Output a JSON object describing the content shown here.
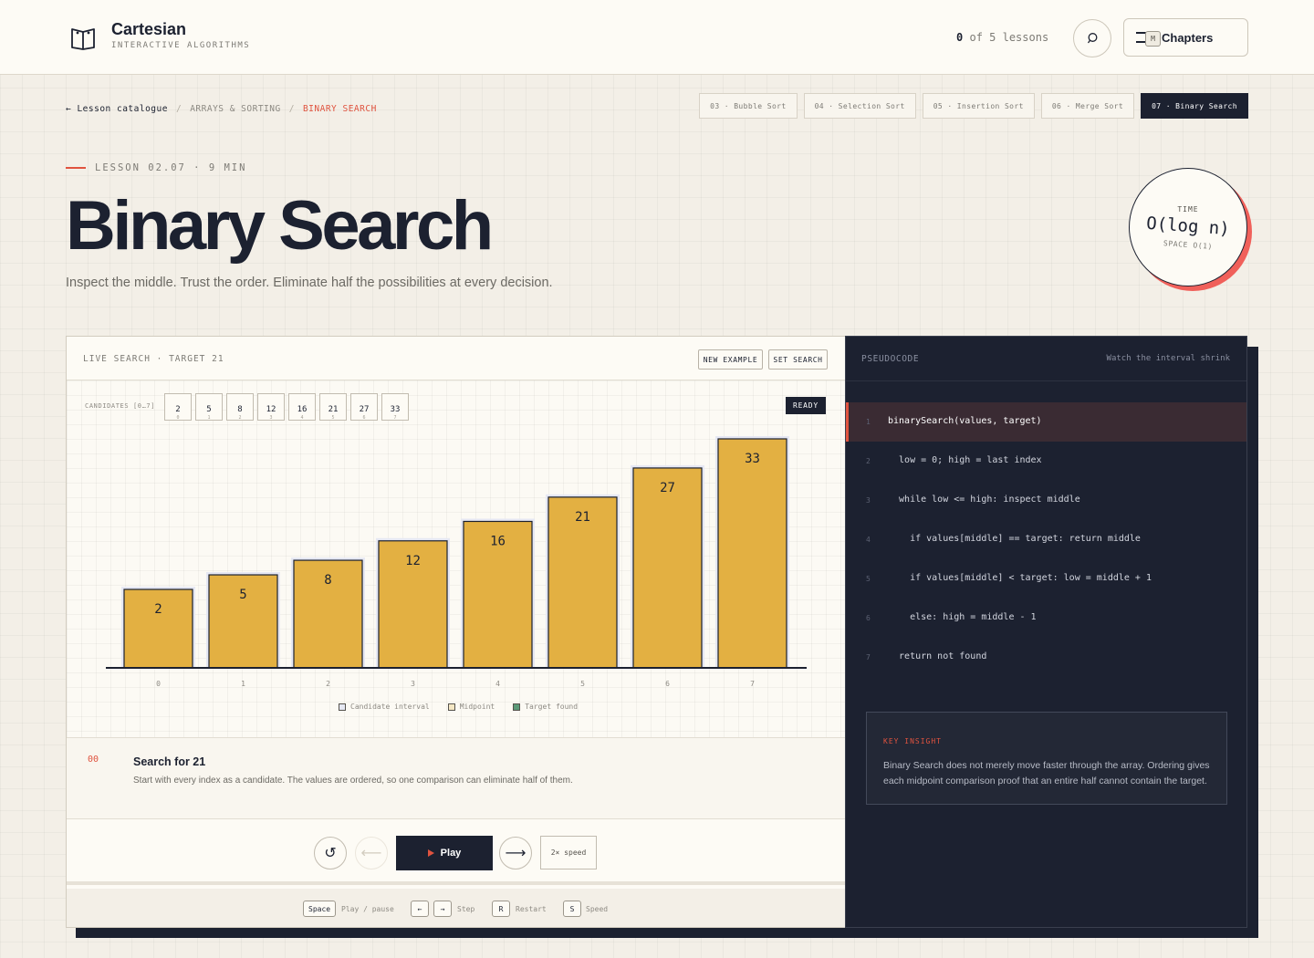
{
  "app": {
    "name": "Cartesian",
    "subtitle": "INTERACTIVE ALGORITHMS",
    "progress_done": "0",
    "progress_rest": "of 5 lessons",
    "chapters_label": "Chapters",
    "chapters_key": "M"
  },
  "breadcrumb": {
    "back": "← Lesson catalogue",
    "section": "ARRAYS & SORTING",
    "current": "BINARY SEARCH",
    "separator": "/"
  },
  "lesson_chips": [
    "03 · Bubble Sort",
    "04 · Selection Sort",
    "05 · Insertion Sort",
    "06 · Merge Sort",
    "07 · Binary Search"
  ],
  "active_chip_index": 4,
  "hero": {
    "eyebrow": "LESSON 02.07 · 9 MIN",
    "title": "Binary Search",
    "subtitle": "Inspect the middle. Trust the order. Eliminate half the possibilities at every decision."
  },
  "complexity": {
    "time_label": "TIME",
    "time_value": "O(log n)",
    "space_label": "SPACE O(1)"
  },
  "visualizer": {
    "header": "LIVE SEARCH · TARGET 21",
    "new_example": "NEW EXAMPLE",
    "set_search": "SET SEARCH",
    "candidates_label": "CANDIDATES [0…7]",
    "status": "READY",
    "legend": [
      "Candidate interval",
      "Midpoint",
      "Target found"
    ],
    "legend_colors": [
      "#e6e8f3",
      "#f4e7c4",
      "#5c9a78"
    ],
    "bar_color": "#e3b042"
  },
  "chart_data": {
    "type": "bar",
    "categories": [
      "0",
      "1",
      "2",
      "3",
      "4",
      "5",
      "6",
      "7"
    ],
    "values": [
      2,
      5,
      8,
      12,
      16,
      21,
      27,
      33
    ]
  },
  "step": {
    "number": "00",
    "title": "Search for 21",
    "description": "Start with every index as a candidate. The values are ordered, so one comparison can eliminate half of them."
  },
  "controls": {
    "restart_icon": "↺",
    "prev_icon": "⟵",
    "play_label": "Play",
    "next_icon": "⟶",
    "speed_label": "2× speed"
  },
  "shortcuts": {
    "space_key": "Space",
    "space_desc": "Play / pause",
    "left_key": "←",
    "right_key": "→",
    "step_desc": "Step",
    "restart_key": "R",
    "restart_desc": "Restart",
    "speed_key": "S",
    "speed_desc": "Speed"
  },
  "pseudocode": {
    "header": "PSEUDOCODE",
    "hint": "Watch the interval shrink",
    "active_line": 1,
    "lines": [
      {
        "n": "1",
        "code": "binarySearch(values, target)"
      },
      {
        "n": "2",
        "code": "  low = 0; high = last index"
      },
      {
        "n": "3",
        "code": "  while low <= high: inspect middle"
      },
      {
        "n": "4",
        "code": "    if values[middle] == target: return middle"
      },
      {
        "n": "5",
        "code": "    if values[middle] < target: low = middle + 1"
      },
      {
        "n": "6",
        "code": "    else: high = middle - 1"
      },
      {
        "n": "7",
        "code": "  return not found"
      }
    ]
  },
  "insight": {
    "heading": "KEY INSIGHT",
    "body": "Binary Search does not merely move faster through the array. Ordering gives each midpoint comparison proof that an entire half cannot contain the target."
  }
}
